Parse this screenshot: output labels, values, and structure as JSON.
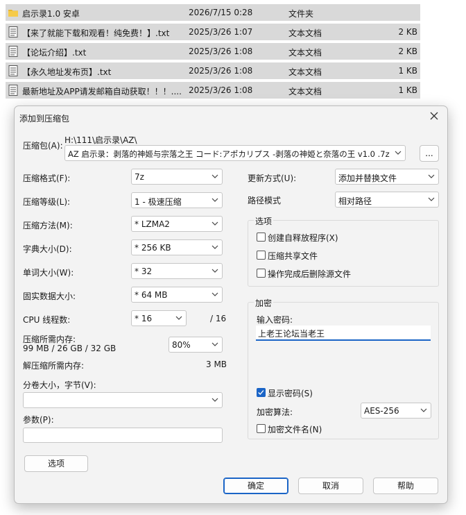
{
  "files": [
    {
      "name": "启示录1.0 安卓",
      "date": "2026/7/15 0:28",
      "type": "文件夹",
      "size": "",
      "icon": "folder-icon"
    },
    {
      "name": "【来了就能下载和观看！纯免费！】.txt",
      "date": "2025/3/26 1:07",
      "type": "文本文档",
      "size": "2 KB",
      "icon": "text-file-icon"
    },
    {
      "name": "【论坛介绍】.txt",
      "date": "2025/3/26 1:08",
      "type": "文本文档",
      "size": "2 KB",
      "icon": "text-file-icon"
    },
    {
      "name": "【永久地址发布页】.txt",
      "date": "2025/3/26 1:08",
      "type": "文本文档",
      "size": "1 KB",
      "icon": "text-file-icon"
    },
    {
      "name": "最新地址及APP请发邮箱自动获取！！！....",
      "date": "2025/3/26 1:08",
      "type": "文本文档",
      "size": "1 KB",
      "icon": "text-file-icon"
    }
  ],
  "dialog": {
    "title": "添加到压缩包",
    "archive_label": "压缩包(A):",
    "archive_path": "H:\\111\\启示录\\AZ\\",
    "archive_name": "AZ 启示录：剥落的神姬与宗落之王 コード:アポカリプス -剥落の神姫と奈落の王 v1.0 .7z",
    "browse_label": "...",
    "format_label": "压缩格式(F):",
    "format_value": "7z",
    "level_label": "压缩等级(L):",
    "level_value": "1 - 极速压缩",
    "method_label": "压缩方法(M):",
    "method_value": "*  LZMA2",
    "dict_label": "字典大小(D):",
    "dict_value": "*  256 KB",
    "word_label": "单词大小(W):",
    "word_value": "*  32",
    "solid_label": "固实数据大小:",
    "solid_value": "*  64 MB",
    "threads_label": "CPU 线程数:",
    "threads_value": "*  16",
    "threads_total": "/ 16",
    "mem_label": "压缩所需内存:",
    "mem_detail": "99 MB / 26 GB / 32 GB",
    "mem_percent": "80%",
    "decomp_label": "解压缩所需内存:",
    "decomp_value": "3 MB",
    "split_label": "分卷大小，字节(V):",
    "split_value": "",
    "params_label": "参数(P):",
    "params_value": "",
    "options_button": "选项",
    "update_label": "更新方式(U):",
    "update_value": "添加并替换文件",
    "pathmode_label": "路径模式",
    "pathmode_value": "相对路径",
    "options_group": "选项",
    "opt_sfx": "创建自释放程序(X)",
    "opt_shared": "压缩共享文件",
    "opt_delete": "操作完成后删除源文件",
    "encrypt_group": "加密",
    "pwd_label": "输入密码:",
    "pwd_value": "上老王论坛当老王",
    "show_pwd": "显示密码(S)",
    "enc_method_label": "加密算法:",
    "enc_method_value": "AES-256",
    "enc_names": "加密文件名(N)",
    "ok": "确定",
    "cancel": "取消",
    "help": "帮助",
    "accent": "#1a64c6"
  }
}
